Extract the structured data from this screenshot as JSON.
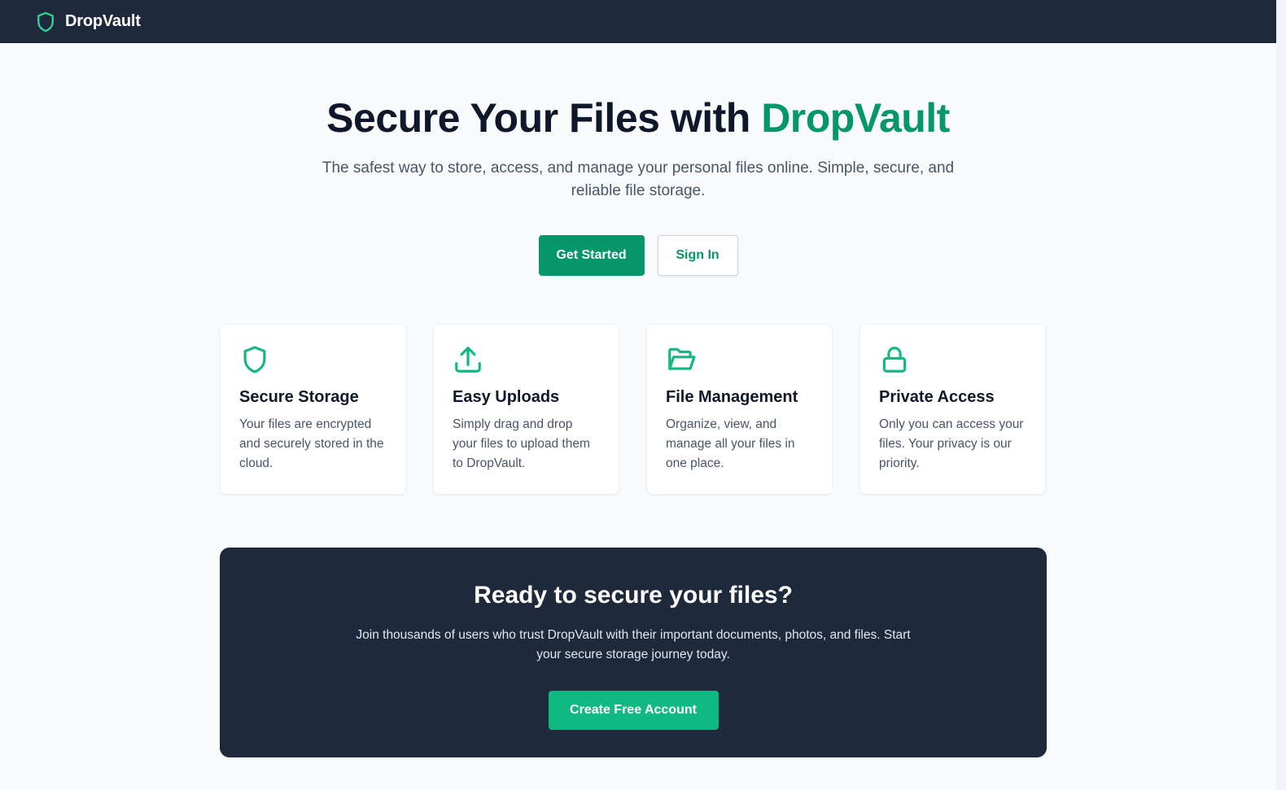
{
  "nav": {
    "brand_name": "DropVault",
    "brand_icon": "shield-icon"
  },
  "hero": {
    "title_prefix": "Secure Your Files with",
    "title_accent": "DropVault",
    "subtitle": "The safest way to store, access, and manage your personal files online. Simple, secure, and reliable file storage.",
    "primary_button": "Get Started",
    "secondary_button": "Sign In"
  },
  "features": [
    {
      "icon": "shield-icon",
      "title": "Secure Storage",
      "text": "Your files are encrypted and securely stored in the cloud."
    },
    {
      "icon": "upload-icon",
      "title": "Easy Uploads",
      "text": "Simply drag and drop your files to upload them to DropVault."
    },
    {
      "icon": "folder-open-icon",
      "title": "File Management",
      "text": "Organize, view, and manage all your files in one place."
    },
    {
      "icon": "lock-icon",
      "title": "Private Access",
      "text": "Only you can access your files. Your privacy is our priority."
    }
  ],
  "cta": {
    "title": "Ready to secure your files?",
    "text": "Join thousands of users who trust DropVault with their important documents, photos, and files. Start your secure storage journey today.",
    "button": "Create Free Account"
  },
  "colors": {
    "brand_green": "#059669",
    "cta_green": "#10b981",
    "icon_green": "#10b981",
    "nav_bg": "#1e293b",
    "page_bg": "#f8fafc"
  }
}
